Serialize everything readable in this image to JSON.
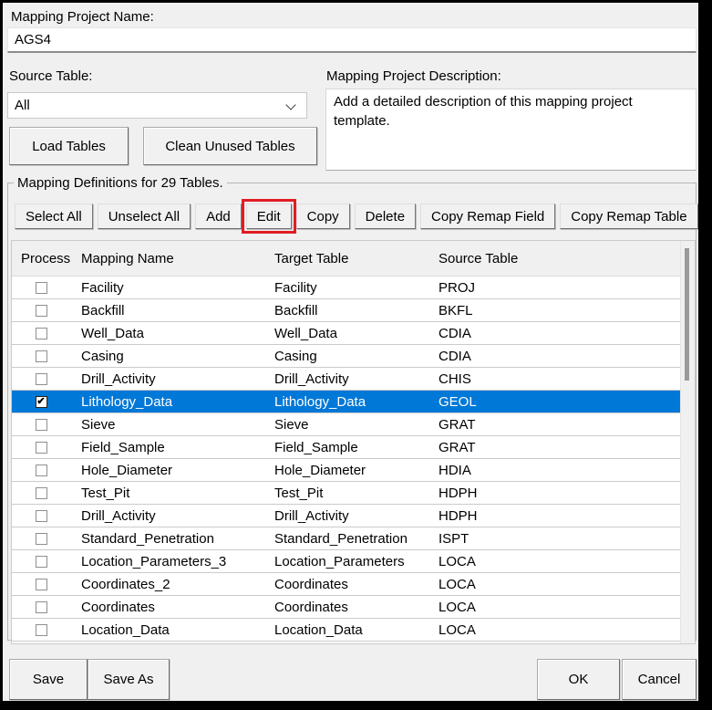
{
  "header": {
    "project_name_label": "Mapping Project Name:",
    "project_name_value": "AGS4",
    "source_table_label": "Source Table:",
    "source_table_selected": "All",
    "load_tables_button": "Load Tables",
    "clean_unused_tables_button": "Clean Unused Tables",
    "description_label": "Mapping Project Description:",
    "description_text": "Add a detailed description of this mapping project template."
  },
  "definitions": {
    "group_title": "Mapping Definitions for 29 Tables.",
    "toolbar_buttons": [
      "Select All",
      "Unselect All",
      "Add",
      "Edit",
      "Copy",
      "Delete",
      "Copy Remap Field",
      "Copy Remap Table"
    ],
    "columns": [
      "Process",
      "Mapping Name",
      "Target Table",
      "Source Table"
    ],
    "rows": [
      {
        "checked": false,
        "selected": false,
        "mapping_name": "Facility",
        "target_table": "Facility",
        "source_table": "PROJ"
      },
      {
        "checked": false,
        "selected": false,
        "mapping_name": "Backfill",
        "target_table": "Backfill",
        "source_table": "BKFL"
      },
      {
        "checked": false,
        "selected": false,
        "mapping_name": "Well_Data",
        "target_table": "Well_Data",
        "source_table": "CDIA"
      },
      {
        "checked": false,
        "selected": false,
        "mapping_name": "Casing",
        "target_table": "Casing",
        "source_table": "CDIA"
      },
      {
        "checked": false,
        "selected": false,
        "mapping_name": "Drill_Activity",
        "target_table": "Drill_Activity",
        "source_table": "CHIS"
      },
      {
        "checked": true,
        "selected": true,
        "mapping_name": "Lithology_Data",
        "target_table": "Lithology_Data",
        "source_table": "GEOL"
      },
      {
        "checked": false,
        "selected": false,
        "mapping_name": "Sieve",
        "target_table": "Sieve",
        "source_table": "GRAT"
      },
      {
        "checked": false,
        "selected": false,
        "mapping_name": "Field_Sample",
        "target_table": "Field_Sample",
        "source_table": "GRAT"
      },
      {
        "checked": false,
        "selected": false,
        "mapping_name": "Hole_Diameter",
        "target_table": "Hole_Diameter",
        "source_table": "HDIA"
      },
      {
        "checked": false,
        "selected": false,
        "mapping_name": "Test_Pit",
        "target_table": "Test_Pit",
        "source_table": "HDPH"
      },
      {
        "checked": false,
        "selected": false,
        "mapping_name": "Drill_Activity",
        "target_table": "Drill_Activity",
        "source_table": "HDPH"
      },
      {
        "checked": false,
        "selected": false,
        "mapping_name": "Standard_Penetration",
        "target_table": "Standard_Penetration",
        "source_table": "ISPT"
      },
      {
        "checked": false,
        "selected": false,
        "mapping_name": "Location_Parameters_3",
        "target_table": "Location_Parameters",
        "source_table": "LOCA"
      },
      {
        "checked": false,
        "selected": false,
        "mapping_name": "Coordinates_2",
        "target_table": "Coordinates",
        "source_table": "LOCA"
      },
      {
        "checked": false,
        "selected": false,
        "mapping_name": "Coordinates",
        "target_table": "Coordinates",
        "source_table": "LOCA"
      },
      {
        "checked": false,
        "selected": false,
        "mapping_name": "Location_Data",
        "target_table": "Location_Data",
        "source_table": "LOCA"
      }
    ]
  },
  "footer": {
    "save_button": "Save",
    "save_as_button": "Save As",
    "ok_button": "OK",
    "cancel_button": "Cancel"
  },
  "annotations": {
    "highlighted_toolbar_button": "Edit",
    "highlight_color": "#e11d23"
  },
  "colors": {
    "selection_blue": "#0078d7",
    "dialog_background": "#f0f0f0"
  },
  "icons": {
    "checkbox_checked_glyph": "✔"
  }
}
